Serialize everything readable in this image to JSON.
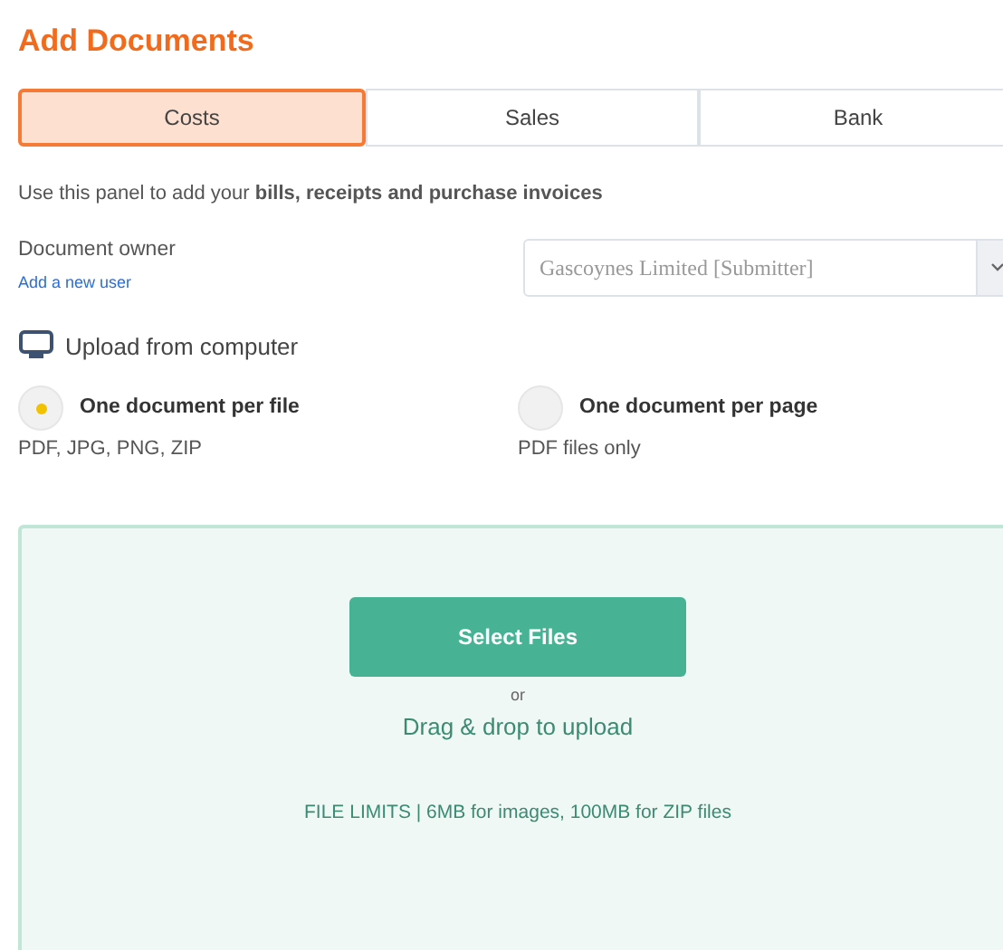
{
  "title": "Add Documents",
  "tabs": [
    {
      "label": "Costs",
      "selected": true
    },
    {
      "label": "Sales",
      "selected": false
    },
    {
      "label": "Bank",
      "selected": false
    }
  ],
  "intro": "Use this panel to add your **bills, receipts and purchase invoices**",
  "owner": {
    "label": "Document owner",
    "link": "Add a new user",
    "value": "Gascoynes Limited [Submitter]"
  },
  "upload_heading": "Upload from computer",
  "modes": [
    {
      "label": "One document per file",
      "note": "PDF, JPG, PNG, ZIP",
      "selected": true
    },
    {
      "label": "One document per page",
      "note": "PDF files only",
      "selected": false
    }
  ],
  "dropzone": {
    "button": "Select Files",
    "or": "or",
    "drag": "Drag & drop to upload",
    "limits": "FILE LIMITS | 6MB for images, 100MB for ZIP files"
  }
}
